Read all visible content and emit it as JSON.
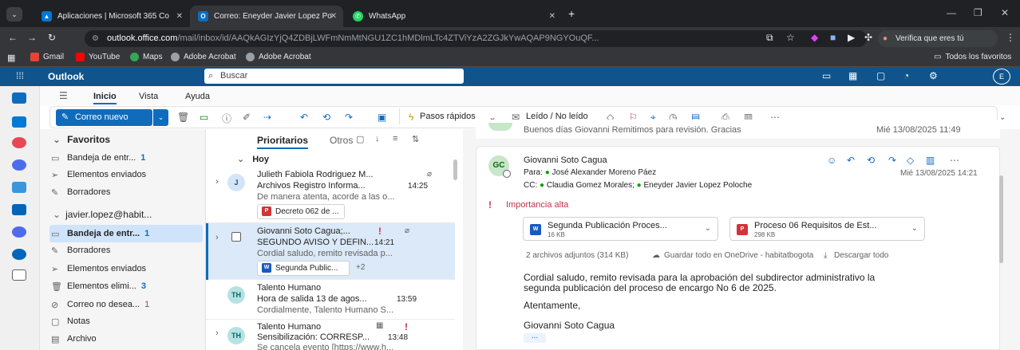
{
  "browser": {
    "tabs": [
      {
        "label": "Aplicaciones | Microsoft 365 Co",
        "icon_color": "#0078d4"
      },
      {
        "label": "Correo: Eneyder Javier Lopez Po",
        "icon_color": "#0f6cbd"
      },
      {
        "label": "WhatsApp",
        "icon_color": "#25d366"
      }
    ],
    "address": {
      "host": "outlook.office.com",
      "path": "/mail/inbox/id/AAQkAGIzYjQ4ZDBjLWFmNmMtNGU1ZC1hMDlmLTc4ZTViYzA2ZGJkYwAQAP9NGYOuQF..."
    },
    "verify_label": "Verifica que eres tú",
    "bookmarks": [
      "Gmail",
      "YouTube",
      "Maps",
      "Adobe Acrobat",
      "Adobe Acrobat"
    ],
    "all_bookmarks": "Todos los favoritos"
  },
  "outlook": {
    "app_name": "Outlook",
    "search_placeholder": "Buscar",
    "ribbon_tabs": [
      "Inicio",
      "Vista",
      "Ayuda"
    ],
    "new_mail": "Correo nuevo",
    "quick_steps": "Pasos rápidos",
    "read_unread": "Leído / No leído"
  },
  "folders": {
    "favorites_label": "Favoritos",
    "favorites": [
      {
        "name": "Bandeja de entr...",
        "count": "1"
      },
      {
        "name": "Elementos enviados",
        "count": ""
      },
      {
        "name": "Borradores",
        "count": ""
      }
    ],
    "account_label": "javier.lopez@habit...",
    "account": [
      {
        "name": "Bandeja de entr...",
        "count": "1"
      },
      {
        "name": "Borradores",
        "count": ""
      },
      {
        "name": "Elementos enviados",
        "count": ""
      },
      {
        "name": "Elementos elimi...",
        "count": "3"
      },
      {
        "name": "Correo no desea...",
        "count": "1"
      },
      {
        "name": "Notas",
        "count": ""
      },
      {
        "name": "Archivo",
        "count": ""
      }
    ]
  },
  "list": {
    "tab_focused": "Prioritarios",
    "tab_other": "Otros",
    "group_today": "Hoy",
    "messages": [
      {
        "initials": "J",
        "sender": "Julieth Fabiola Rodriguez M...",
        "subject": "Archivos Registro Informa...",
        "time": "14:25",
        "preview": "De manera atenta, acorde a las o...",
        "attachment": "Decreto 062 de ...",
        "extra": ""
      },
      {
        "initials": "",
        "sender": "Giovanni Soto Cagua;...",
        "subject": "SEGUNDO AVISO Y DEFIN...",
        "time": "14:21",
        "preview": "Cordial saludo, remito revisada p...",
        "attachment": "Segunda Public...",
        "extra": "+2"
      },
      {
        "initials": "TH",
        "sender": "Talento Humano",
        "subject": "Hora de salida 13 de agos...",
        "time": "13:59",
        "preview": "Cordialmente, Talento Humano S...",
        "attachment": "",
        "extra": ""
      },
      {
        "initials": "TH",
        "sender": "Talento Humano",
        "subject": "Sensibilización: CORRESP...",
        "time": "13:48",
        "preview": "Se cancela evento [https://www.h...",
        "attachment": "",
        "extra": ""
      }
    ]
  },
  "reading": {
    "prev_preview": "Buenos días Giovanni Remitimos para revisión. Gracias",
    "prev_date": "Mié 13/08/2025 11:49",
    "initials": "GC",
    "sender": "Giovanni Soto Cagua",
    "to_label": "Para:",
    "to": "José Alexander Moreno Páez",
    "date": "Mié 13/08/2025 14:21",
    "cc_label": "CC:",
    "cc": [
      "Claudia Gomez Morales;",
      "Eneyder Javier Lopez Poloche"
    ],
    "importance": "Importancia alta",
    "attachments": [
      {
        "name": "Segunda Publicación Proces...",
        "size": "16 KB"
      },
      {
        "name": "Proceso 06 Requisitos de Est...",
        "size": "298 KB"
      }
    ],
    "attach_summary": "2 archivos adjuntos (314 KB)",
    "save_onedrive": "Guardar todo en OneDrive - habitatbogota",
    "download_all": "Descargar todo",
    "body_1": "Cordial saludo, remito revisada para la aprobación del subdirector administrativo la",
    "body_2": "segunda publicación del proceso de encargo No 6 de 2025.",
    "closing": "Atentamente,",
    "signature": "Giovanni Soto Cagua",
    "more": "..."
  },
  "colors": {
    "brand": "#0f548c",
    "accent": "#0f6cbd",
    "selected": "#cfe4fa",
    "important": "#c4314b",
    "presence": "#13a10e"
  }
}
